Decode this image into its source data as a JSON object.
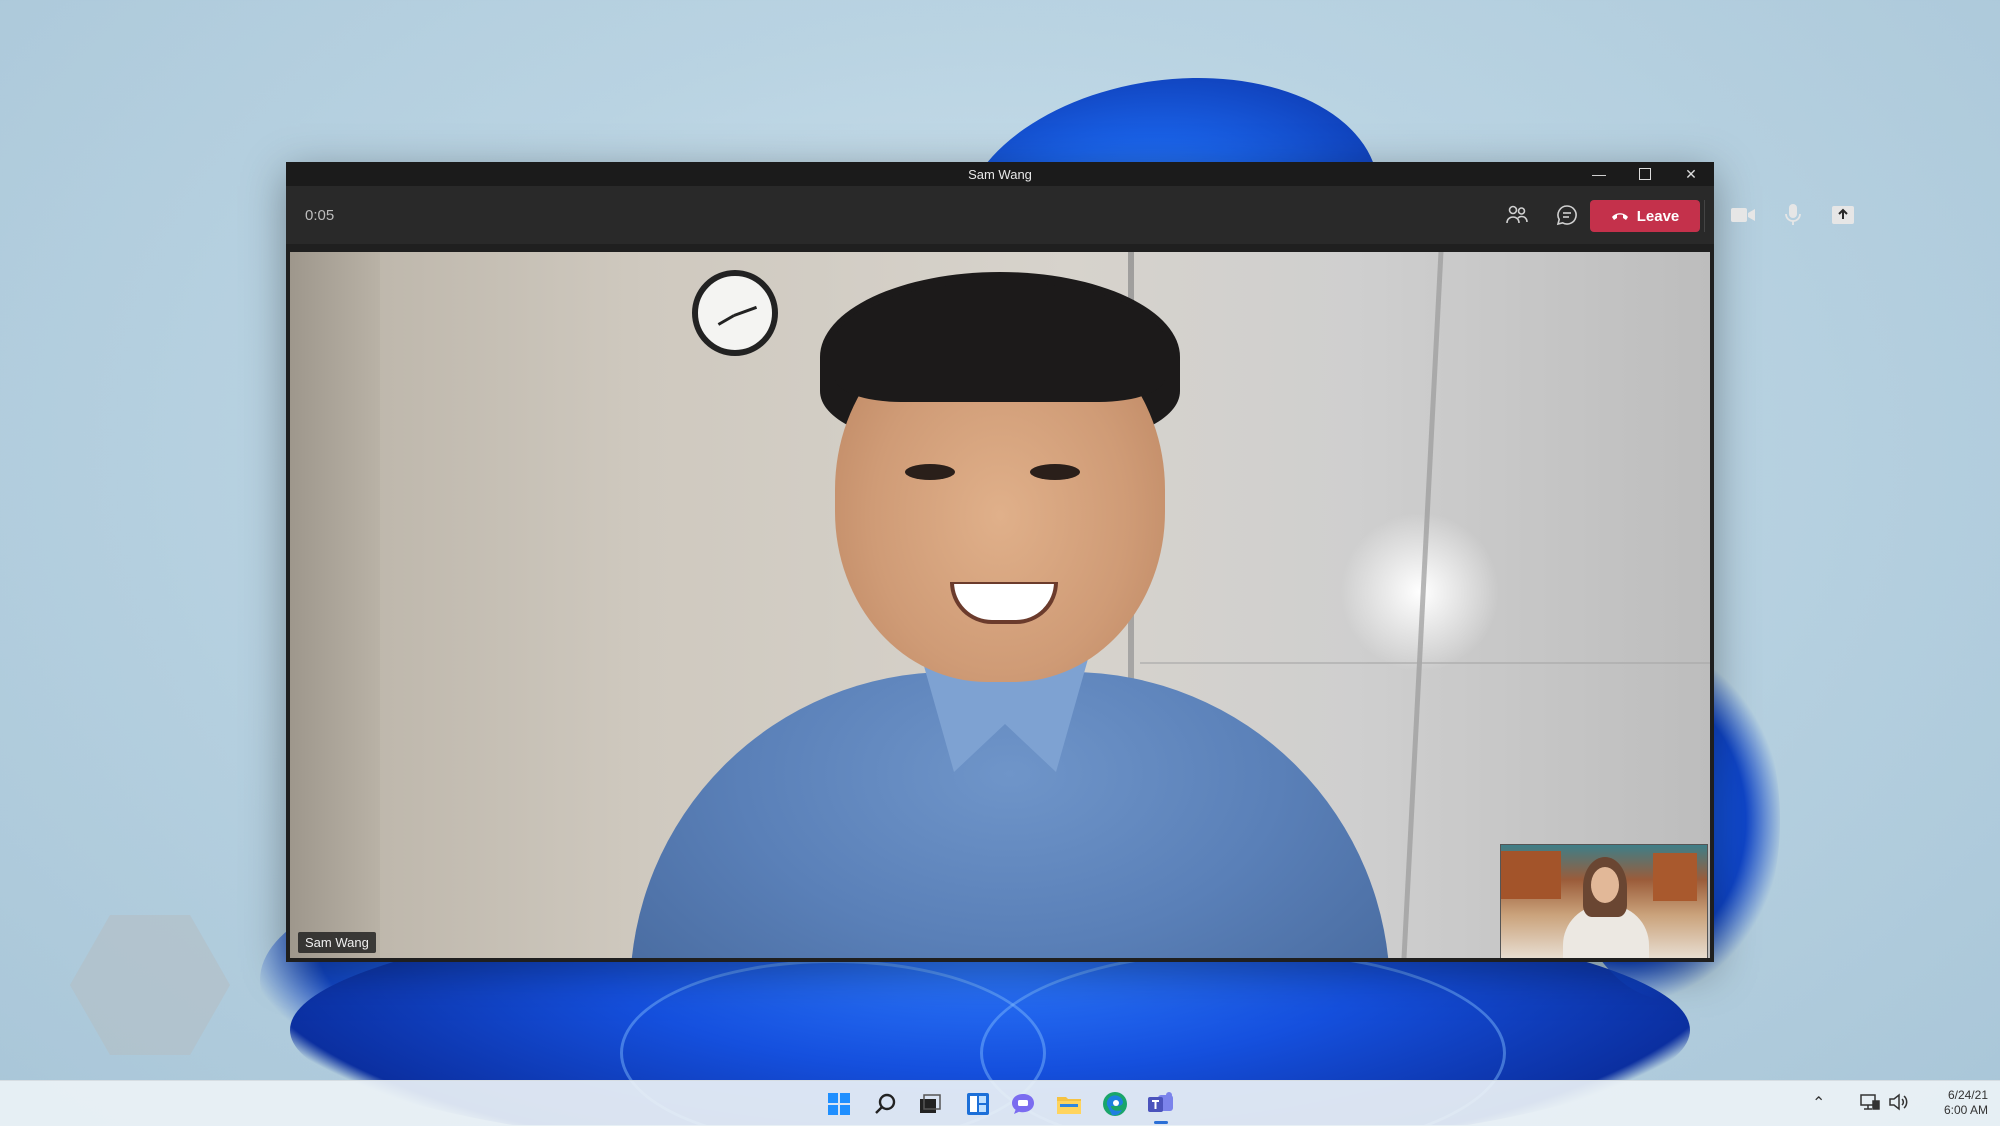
{
  "window": {
    "title": "Sam Wang"
  },
  "toolbar": {
    "timer": "0:05",
    "leave_label": "Leave"
  },
  "stage": {
    "participant_name": "Sam Wang"
  },
  "taskbar": {
    "date": "6/24/21",
    "time": "6:00 AM"
  },
  "colors": {
    "leave_button": "#c4314b",
    "titlebar": "#1b1b1b",
    "toolbar": "#292929",
    "taskbar": "#ecf2f6",
    "accent": "#2b6fd6"
  },
  "icons": {
    "toolbar": [
      "people-icon",
      "chat-icon",
      "react-icon",
      "more-icon",
      "camera-icon",
      "microphone-icon",
      "share-icon",
      "phone-hangup-icon"
    ],
    "taskbar": [
      "start-icon",
      "search-icon",
      "task-view-icon",
      "widgets-icon",
      "chat-icon",
      "file-explorer-icon",
      "edge-icon",
      "teams-icon"
    ]
  }
}
